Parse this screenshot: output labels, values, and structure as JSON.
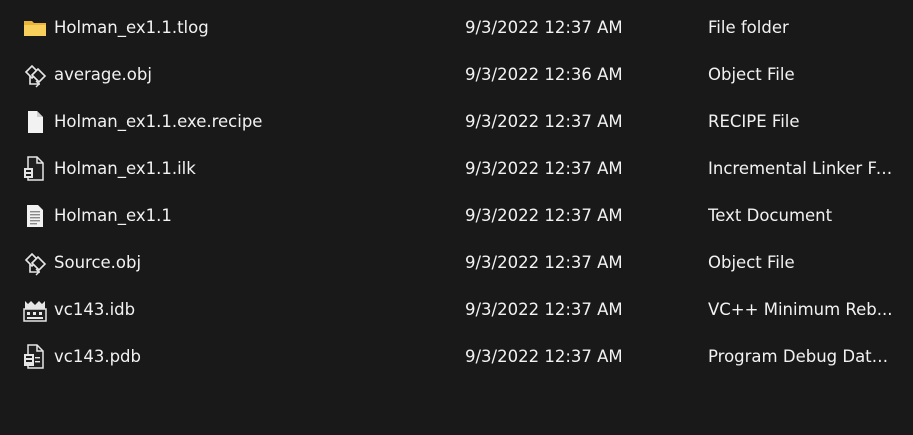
{
  "files": [
    {
      "name": "Holman_ex1.1.tlog",
      "date": "9/3/2022 12:37 AM",
      "type": "File folder",
      "icon": "folder-icon"
    },
    {
      "name": "average.obj",
      "date": "9/3/2022 12:36 AM",
      "type": "Object File",
      "icon": "object-file-icon"
    },
    {
      "name": "Holman_ex1.1.exe.recipe",
      "date": "9/3/2022 12:37 AM",
      "type": "RECIPE File",
      "icon": "blank-file-icon"
    },
    {
      "name": "Holman_ex1.1.ilk",
      "date": "9/3/2022 12:37 AM",
      "type": "Incremental Linker File",
      "icon": "linker-file-icon"
    },
    {
      "name": "Holman_ex1.1",
      "date": "9/3/2022 12:37 AM",
      "type": "Text Document",
      "icon": "text-document-icon"
    },
    {
      "name": "Source.obj",
      "date": "9/3/2022 12:37 AM",
      "type": "Object File",
      "icon": "object-file-icon"
    },
    {
      "name": "vc143.idb",
      "date": "9/3/2022 12:37 AM",
      "type": "VC++ Minimum Reb...",
      "icon": "idb-file-icon"
    },
    {
      "name": "vc143.pdb",
      "date": "9/3/2022 12:37 AM",
      "type": "Program Debug Data...",
      "icon": "pdb-file-icon"
    }
  ],
  "colors": {
    "background": "#191919",
    "text": "#f2f2f2",
    "folder": "#f4c542"
  }
}
